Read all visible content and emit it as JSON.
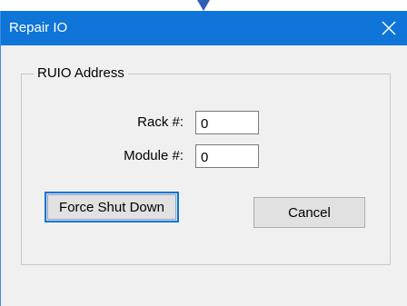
{
  "window": {
    "title": "Repair IO"
  },
  "icons": {
    "close": "close-icon",
    "pointer": "pointer-arrow-icon"
  },
  "colors": {
    "titlebar": "#0f75d8",
    "dialog_background": "#f0f0f0",
    "focus_border": "#0a74d6"
  },
  "group": {
    "label": "RUIO Address",
    "rack": {
      "label": "Rack #:",
      "value": "0"
    },
    "module": {
      "label": "Module #:",
      "value": "0"
    }
  },
  "buttons": {
    "force_shut_down": "Force Shut Down",
    "cancel": "Cancel"
  }
}
